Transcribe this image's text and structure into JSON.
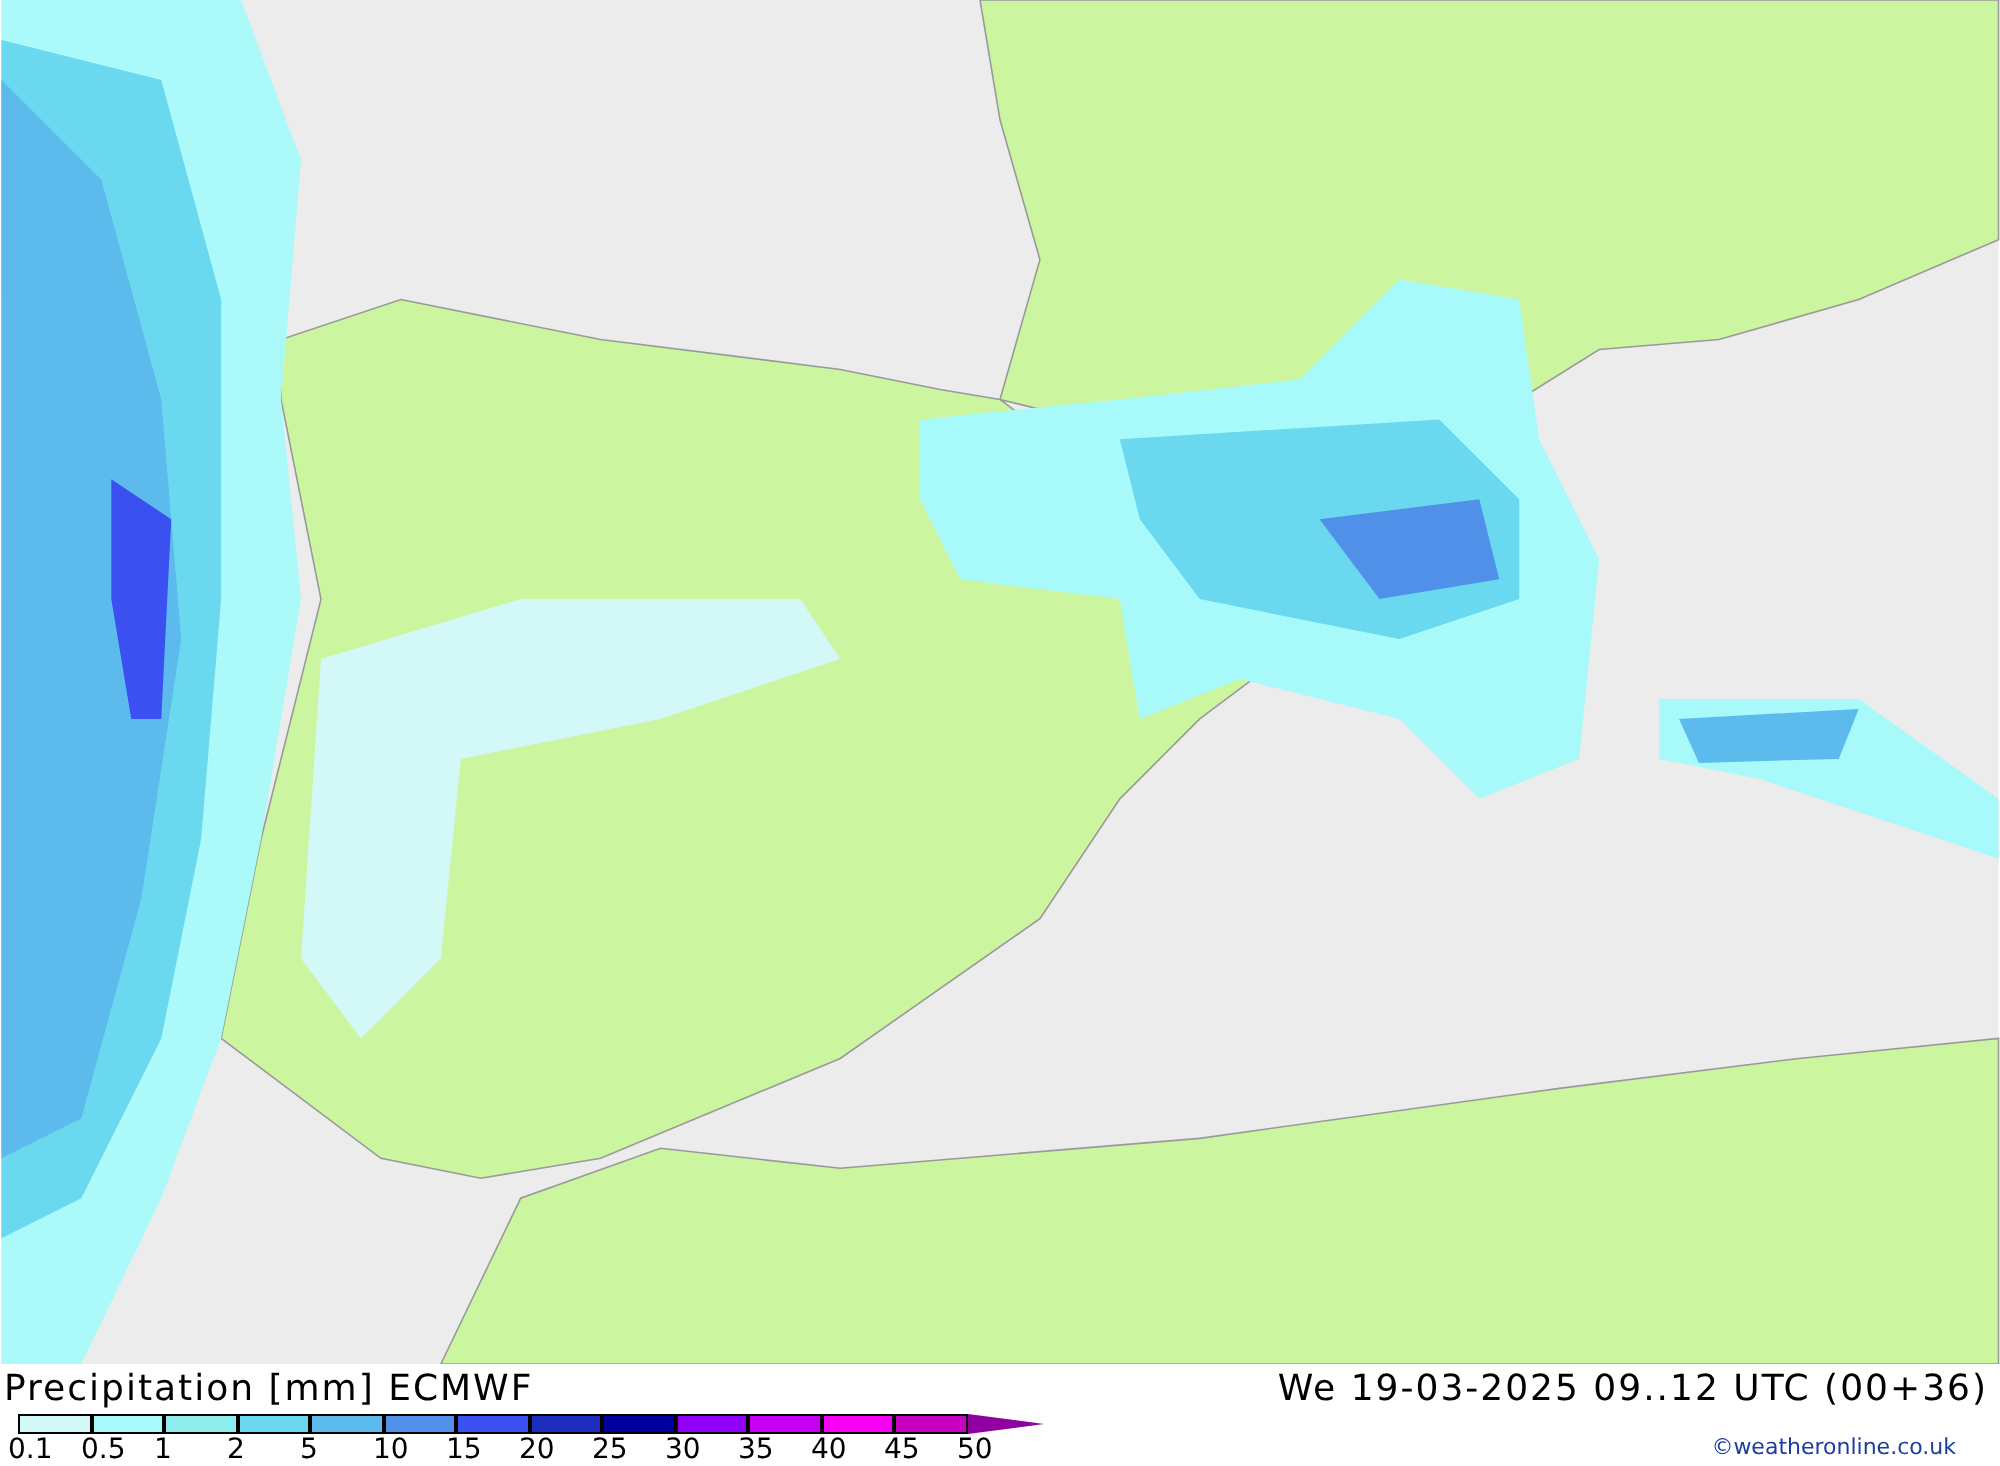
{
  "title": "Precipitation [mm] ECMWF",
  "valid_time": "We 19-03-2025 09..12 UTC (00+36)",
  "legend": [
    {
      "label": "0.1",
      "color": "#d2f8f8"
    },
    {
      "label": "0.5",
      "color": "#a8fafa"
    },
    {
      "label": "1",
      "color": "#8eecec"
    },
    {
      "label": "2",
      "color": "#6ad8ee"
    },
    {
      "label": "5",
      "color": "#5cbaec"
    },
    {
      "label": "10",
      "color": "#5090e8"
    },
    {
      "label": "15",
      "color": "#3a50f0"
    },
    {
      "label": "20",
      "color": "#1c2cbc"
    },
    {
      "label": "25",
      "color": "#0000a0"
    },
    {
      "label": "30",
      "color": "#9000f4"
    },
    {
      "label": "35",
      "color": "#c400f0"
    },
    {
      "label": "40",
      "color": "#f400f4"
    },
    {
      "label": "45",
      "color": "#c800c0"
    }
  ],
  "legend_end": "50",
  "credit": "©weatheronline.co.uk"
}
